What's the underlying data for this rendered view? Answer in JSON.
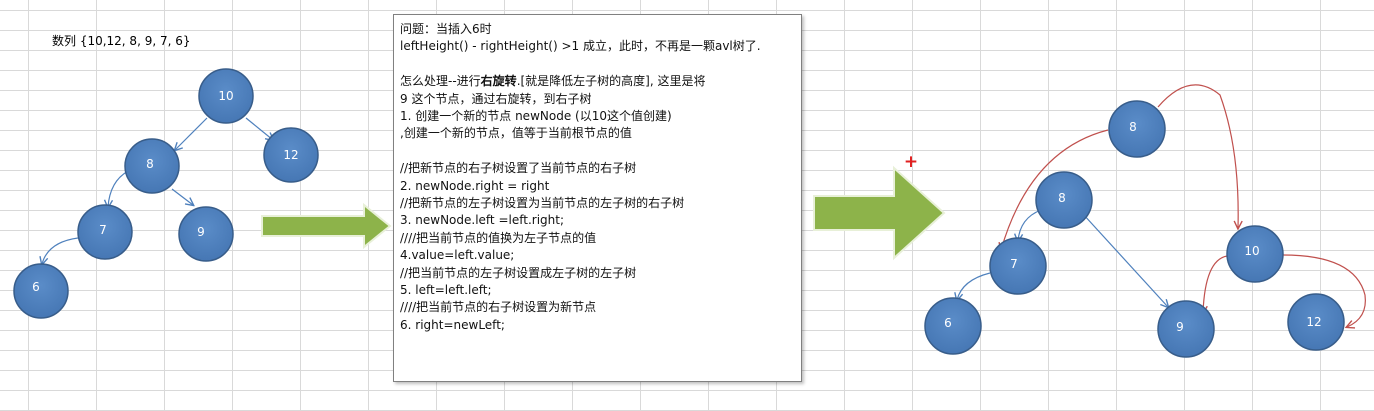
{
  "sequence_label": "数列 {10,12, 8, 9, 7, 6}",
  "plus_sign": "+",
  "colors": {
    "node_fill": "#4f81bd",
    "node_stroke": "#385d8a",
    "edge_blue": "#4f81bd",
    "edge_red": "#c0504d",
    "arrow_green": "#8db34a"
  },
  "explanation": {
    "line1": "问题：当插入6时",
    "line2": "leftHeight() - rightHeight() >1 成立，此时，不再是一颗avl树了.",
    "line3": "",
    "line4_pre": "怎么处理--进行",
    "line4_bold": "右旋转",
    "line4_post": ".[就是降低左子树的高度], 这里是将",
    "line5": "9 这个节点，通过右旋转，到右子树",
    "line6": "1. 创建一个新的节点 newNode (以10这个值创建)",
    "line7": ",创建一个新的节点，值等于当前根节点的值",
    "line8": "",
    "line9": "//把新节点的右子树设置了当前节点的右子树",
    "line10": "2. newNode.right = right",
    "line11": "//把新节点的左子树设置为当前节点的左子树的右子树",
    "line12": "3. newNode.left =left.right;",
    "line13": "////把当前节点的值换为左子节点的值",
    "line14": "4.value=left.value;",
    "line15": "//把当前节点的左子树设置成左子树的左子树",
    "line16": "5. left=left.left;",
    "line17": "////把当前节点的右子树设置为新节点",
    "line18": "6. right=newLeft;"
  },
  "left_tree": {
    "nodes": [
      "10",
      "12",
      "8",
      "7",
      "9",
      "6"
    ]
  },
  "right_tree": {
    "nodes": [
      "8",
      "8",
      "7",
      "10",
      "6",
      "9",
      "12"
    ]
  }
}
